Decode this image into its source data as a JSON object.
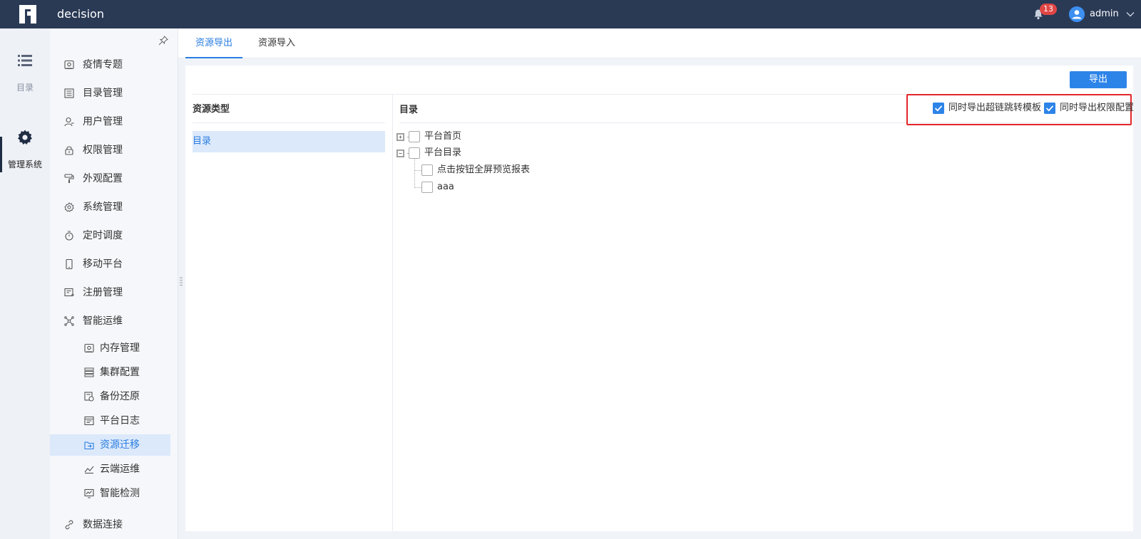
{
  "app": {
    "title": "decision"
  },
  "header": {
    "notification_count": "13",
    "user_name": "admin"
  },
  "rail": {
    "items": [
      {
        "label": "目录",
        "icon": "list-icon",
        "active": false
      },
      {
        "label": "管理系统",
        "icon": "gear-icon",
        "active": true
      }
    ]
  },
  "subnav": {
    "items": [
      {
        "label": "疫情专题",
        "icon": "dashboard-icon"
      },
      {
        "label": "目录管理",
        "icon": "directory-icon"
      },
      {
        "label": "用户管理",
        "icon": "user-icon"
      },
      {
        "label": "权限管理",
        "icon": "lock-icon"
      },
      {
        "label": "外观配置",
        "icon": "paint-roller-icon"
      },
      {
        "label": "系统管理",
        "icon": "gear-icon"
      },
      {
        "label": "定时调度",
        "icon": "timer-icon"
      },
      {
        "label": "移动平台",
        "icon": "mobile-icon"
      },
      {
        "label": "注册管理",
        "icon": "register-icon"
      },
      {
        "label": "智能运维",
        "icon": "network-icon"
      }
    ],
    "sub_items": [
      {
        "label": "内存管理",
        "icon": "memory-icon"
      },
      {
        "label": "集群配置",
        "icon": "cluster-icon"
      },
      {
        "label": "备份还原",
        "icon": "backup-icon"
      },
      {
        "label": "平台日志",
        "icon": "log-icon"
      },
      {
        "label": "资源迁移",
        "icon": "migrate-icon",
        "active": true
      },
      {
        "label": "云端运维",
        "icon": "cloud-ops-icon"
      },
      {
        "label": "智能检测",
        "icon": "monitor-icon"
      }
    ],
    "bottom_item": {
      "label": "数据连接",
      "icon": "link-icon"
    }
  },
  "tabs": [
    {
      "label": "资源导出",
      "active": true
    },
    {
      "label": "资源导入",
      "active": false
    }
  ],
  "panel": {
    "export_label": "导出",
    "resource_type_header": "资源类型",
    "resource_types": [
      "目录"
    ],
    "directory_header": "目录",
    "options": [
      {
        "label": "同时导出超链跳转模板",
        "checked": true
      },
      {
        "label": "同时导出权限配置",
        "checked": true
      }
    ],
    "tree": [
      {
        "label": "平台首页",
        "expanded": false,
        "checked": false
      },
      {
        "label": "平台目录",
        "expanded": true,
        "checked": false,
        "children": [
          {
            "label": "点击按钮全屏预览报表",
            "checked": false
          },
          {
            "label": "aaa",
            "checked": false
          }
        ]
      }
    ]
  },
  "colors": {
    "topbar": "#2a3a55",
    "accent": "#2d84e8",
    "highlight": "#e3262b"
  }
}
